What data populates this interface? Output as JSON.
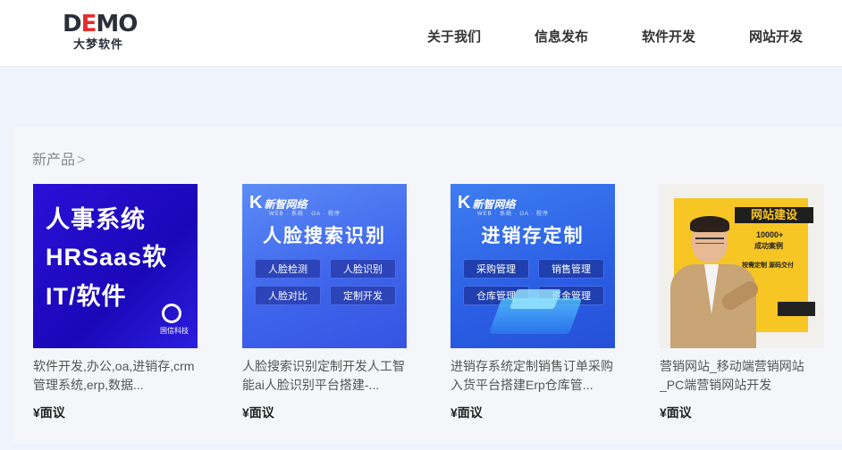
{
  "brand": {
    "logo_main_pre": "D",
    "logo_main_red": "E",
    "logo_main_post": "MO",
    "logo_sub": "大梦软件"
  },
  "nav": [
    {
      "label": "关于我们"
    },
    {
      "label": "信息发布"
    },
    {
      "label": "软件开发"
    },
    {
      "label": "网站开发"
    }
  ],
  "section": {
    "title": "新产品",
    "chevron": ">"
  },
  "products": [
    {
      "title": "软件开发,办公,oa,进销存,crm管理系统,erp,数据...",
      "price": "¥面议",
      "image": {
        "lines": [
          "人事系统",
          "HRSaas软",
          "IT/软件"
        ],
        "logo_text": "国信科技"
      }
    },
    {
      "title": "人脸搜索识别定制开发人工智能ai人脸识别平台搭建-...",
      "price": "¥面议",
      "image": {
        "brand": "新智网络",
        "brand_sub": "WEB · 系统 · OA · 程序",
        "headline": "人脸搜索识别",
        "pills": [
          "人脸检测",
          "人脸识别",
          "人脸对比",
          "定制开发"
        ]
      }
    },
    {
      "title": "进销存系统定制销售订单采购入货平台搭建Erp仓库管...",
      "price": "¥面议",
      "image": {
        "brand": "新智网络",
        "brand_sub": "WEB · 系统 · OA · 程序",
        "headline": "进销存定制",
        "pills": [
          "采购管理",
          "销售管理",
          "仓库管理",
          "资金管理"
        ]
      }
    },
    {
      "title": "营销网站_移动端营销网站_PC端营销网站开发",
      "price": "¥面议",
      "image": {
        "headline": "网站建设",
        "count_line1": "10000+",
        "count_line2": "成功案例",
        "tagline": "按需定制 源码交付"
      }
    }
  ],
  "colors": {
    "page_bg": "#eef3fc",
    "panel_bg": "#f4f6fa",
    "logo_accent": "#e52d2d",
    "card1_bg": "#2a10d8",
    "card2_bg": "#3f66ec",
    "card4_accent": "#f7c625"
  }
}
